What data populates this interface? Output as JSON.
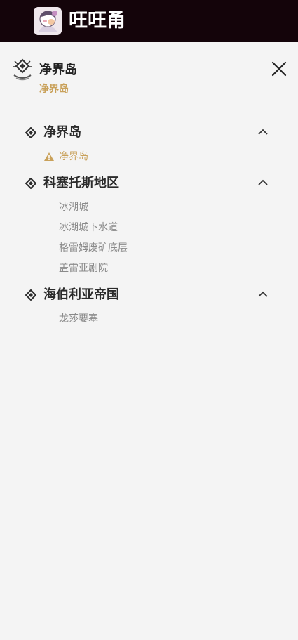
{
  "topbar": {
    "brand": "㕵㕵甬"
  },
  "header": {
    "title": "净界岛",
    "subtitle": "净界岛",
    "icons": {
      "region": "region-compass-icon",
      "close": "close-icon"
    }
  },
  "sections": [
    {
      "title": "净界岛",
      "expanded": true,
      "items": [
        {
          "label": "净界岛",
          "active": true,
          "icon": "warning-triangle-icon"
        }
      ]
    },
    {
      "title": "科塞托斯地区",
      "expanded": true,
      "items": [
        {
          "label": "冰湖城"
        },
        {
          "label": "冰湖城下水道"
        },
        {
          "label": "格雷姆废矿底层"
        },
        {
          "label": "盖雷亚剧院"
        }
      ]
    },
    {
      "title": "海伯利亚帝国",
      "expanded": true,
      "items": [
        {
          "label": "龙莎要塞"
        }
      ]
    }
  ],
  "colors": {
    "topbar_bg": "#14040a",
    "page_bg": "#f4f4f4",
    "accent_gold": "#c9a15a",
    "title_text": "#2b2b2b",
    "sub_text": "#8a8a8a"
  }
}
